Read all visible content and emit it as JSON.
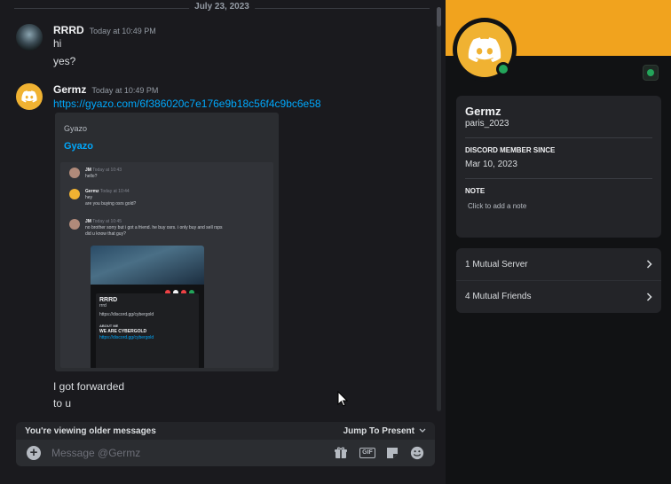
{
  "chat": {
    "date_divider": "July 23, 2023",
    "messages": [
      {
        "author": "RRRD",
        "timestamp": "Today at 10:49 PM",
        "lines": [
          "hi",
          "yes?"
        ]
      },
      {
        "author": "Germz",
        "timestamp": "Today at 10:49 PM",
        "lines": [
          "https://gyazo.com/6f386020c7e176e9b18c56f4c9bc6e58"
        ]
      }
    ],
    "embed": {
      "provider": "Gyazo",
      "title": "Gyazo",
      "screenshot": {
        "rows": [
          {
            "author": "JM",
            "time": "Today at 10:43",
            "text": "hello?"
          },
          {
            "author": "Germz",
            "time": "Today at 10:44",
            "text": "hey",
            "text2": "are you buying osrs gold?"
          },
          {
            "author": "JM",
            "time": "Today at 10:45",
            "text": "no brother sorry but i got a friend. he buy osrs. i only buy and sell rsps",
            "text2": "did u know that guy?"
          }
        ],
        "card": {
          "name": "RRRD",
          "handle": "rrrd",
          "link": "https://discord.gg/cybergold",
          "about_label": "ABOUT ME",
          "about_title": "WE ARE CYBERGOLD",
          "about_link": "https://discord.gg/cybergold"
        }
      }
    },
    "trailing_lines": [
      "I got forwarded",
      "to u"
    ],
    "older_banner": "You're viewing older messages",
    "jump_label": "Jump To Present",
    "composer_placeholder": "Message @Germz",
    "tools": [
      "gift-icon",
      "gif-icon",
      "sticker-icon",
      "emoji-icon"
    ],
    "gif_label": "GIF"
  },
  "profile": {
    "display_name": "Germz",
    "username": "paris_2023",
    "member_since_label": "DISCORD MEMBER SINCE",
    "member_since": "Mar 10, 2023",
    "note_label": "NOTE",
    "note_placeholder": "Click to add a note",
    "mutual_servers": "1 Mutual Server",
    "mutual_friends": "4 Mutual Friends",
    "banner_color": "#f1a31e",
    "status": "online"
  },
  "colors": {
    "accent_link": "#00a8fc",
    "online": "#23a55a",
    "avatar_yellow": "#f0b232"
  }
}
